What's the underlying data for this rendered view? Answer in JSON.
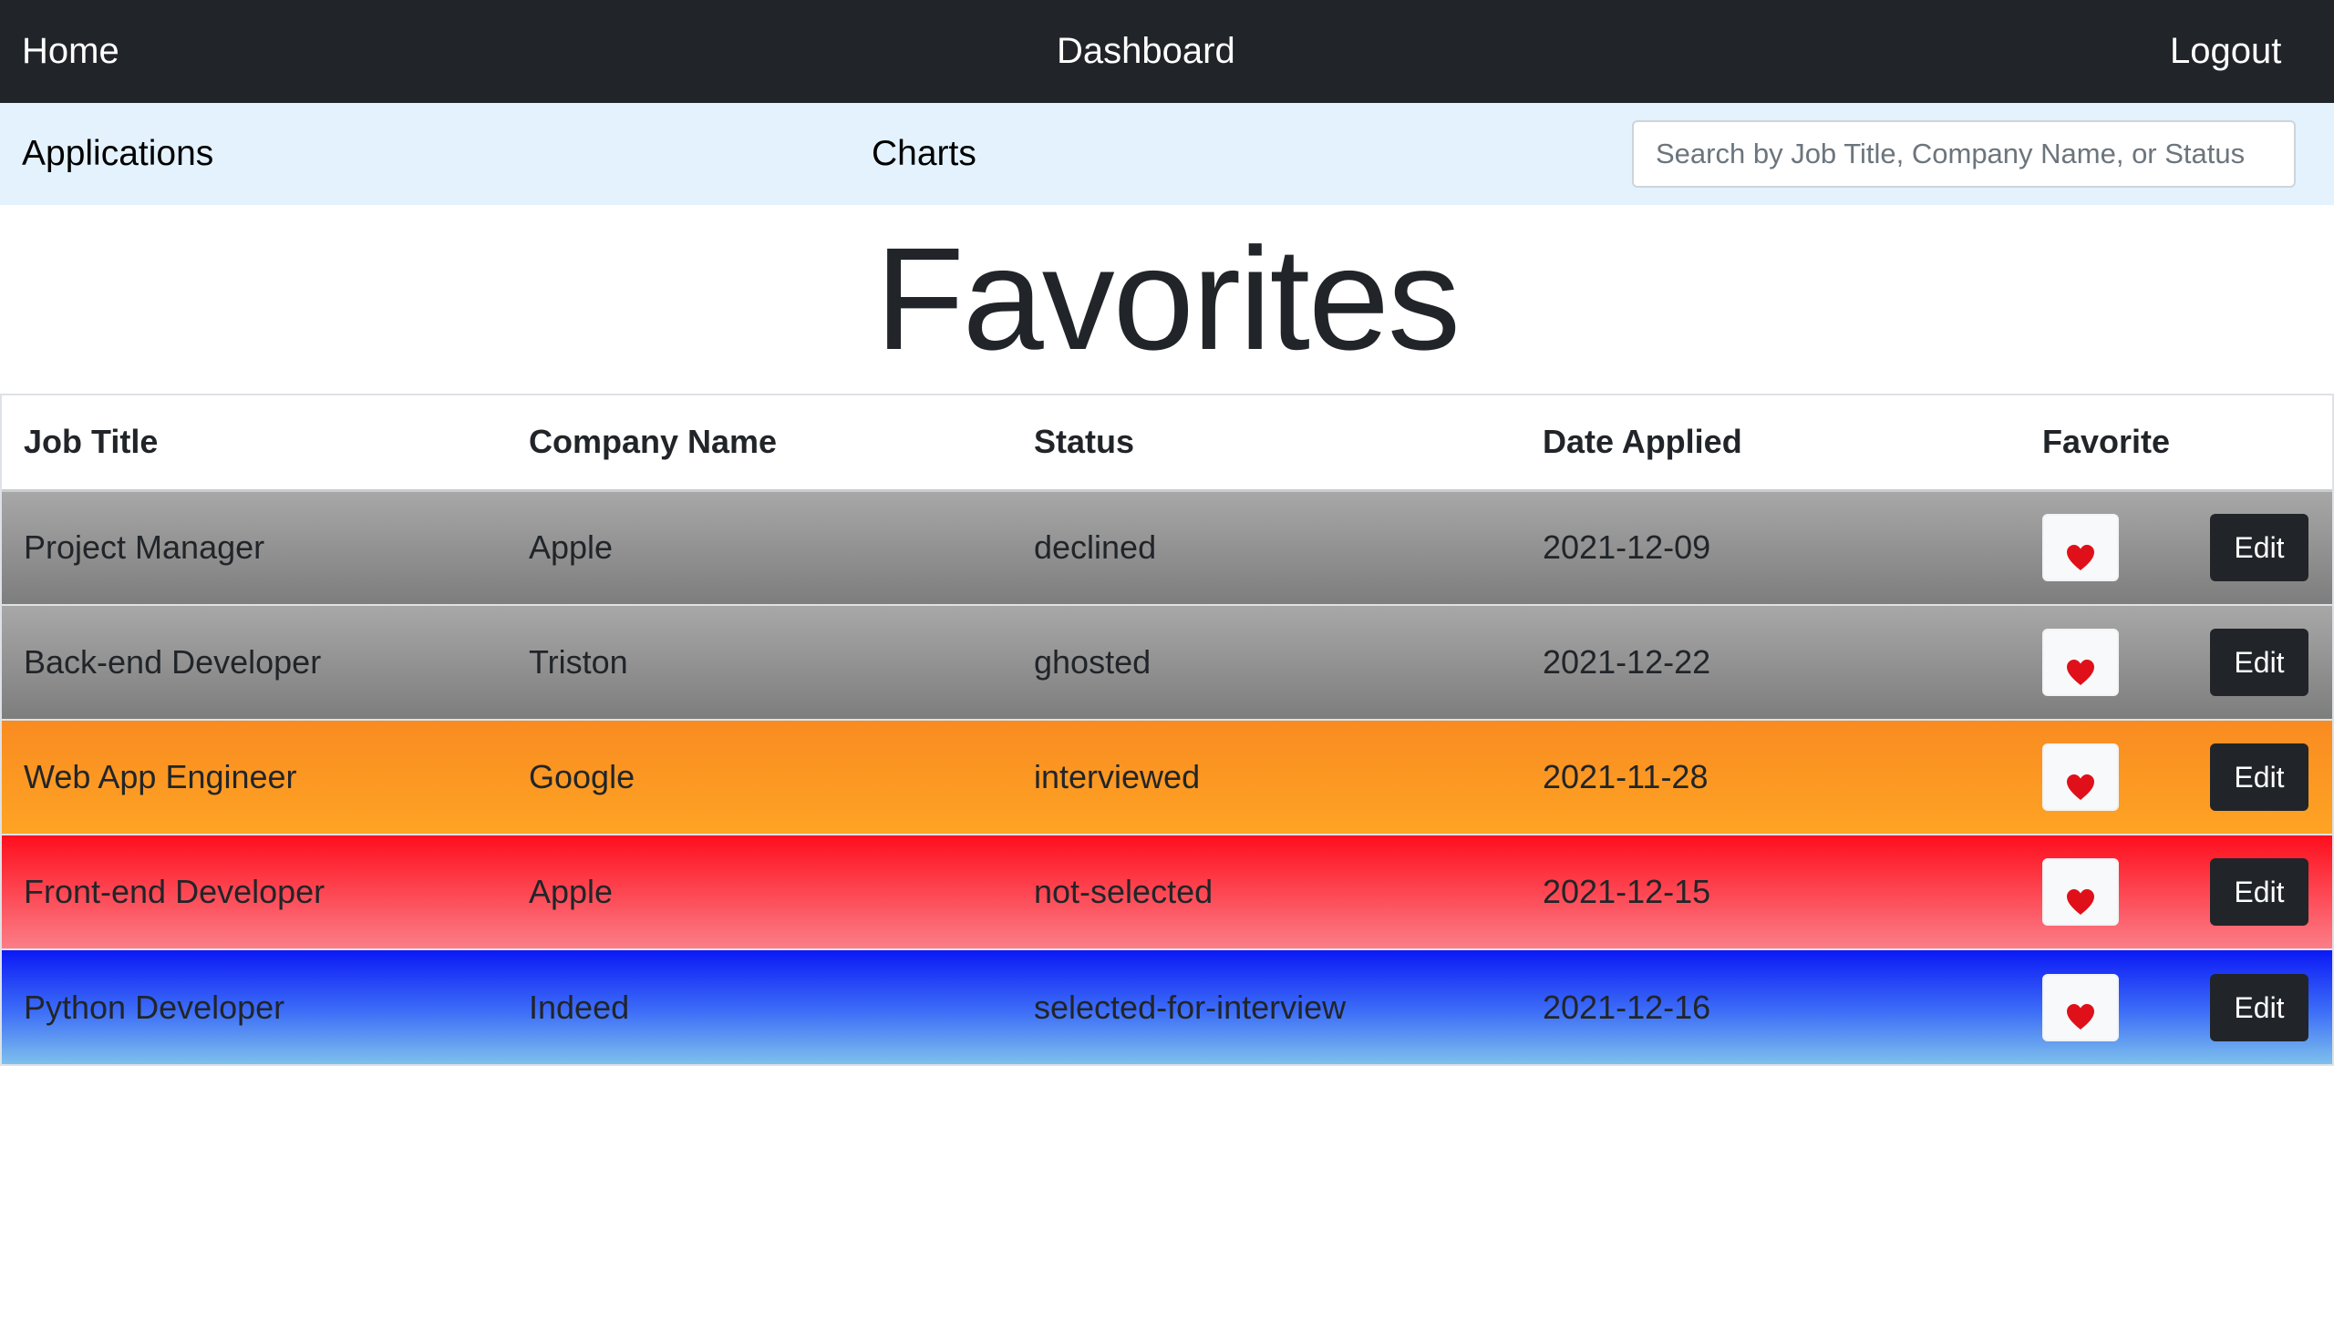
{
  "topnav": {
    "home": "Home",
    "dashboard": "Dashboard",
    "logout": "Logout"
  },
  "subnav": {
    "applications": "Applications",
    "charts": "Charts",
    "search_placeholder": "Search by Job Title, Company Name, or Status",
    "search_value": ""
  },
  "page": {
    "title": "Favorites"
  },
  "table": {
    "headers": {
      "job_title": "Job Title",
      "company_name": "Company Name",
      "status": "Status",
      "date_applied": "Date Applied",
      "favorite": "Favorite"
    },
    "edit_label": "Edit",
    "favorite_icon": "heart-icon",
    "favorite_color": "#e0101a",
    "rows": [
      {
        "job_title": "Project Manager",
        "company_name": "Apple",
        "status": "declined",
        "date_applied": "2021-12-09",
        "favorite": true
      },
      {
        "job_title": "Back-end Developer",
        "company_name": "Triston",
        "status": "ghosted",
        "date_applied": "2021-12-22",
        "favorite": true
      },
      {
        "job_title": "Web App Engineer",
        "company_name": "Google",
        "status": "interviewed",
        "date_applied": "2021-11-28",
        "favorite": true
      },
      {
        "job_title": "Front-end Developer",
        "company_name": "Apple",
        "status": "not-selected",
        "date_applied": "2021-12-15",
        "favorite": true
      },
      {
        "job_title": "Python Developer",
        "company_name": "Indeed",
        "status": "selected-for-interview",
        "date_applied": "2021-12-16",
        "favorite": true
      }
    ]
  },
  "status_colors": {
    "declined": "#8f8f8f",
    "ghosted": "#8f8f8f",
    "interviewed": "#fb9a22",
    "not-selected": "#ff3a45",
    "selected-for-interview": "#1a3ff5"
  }
}
